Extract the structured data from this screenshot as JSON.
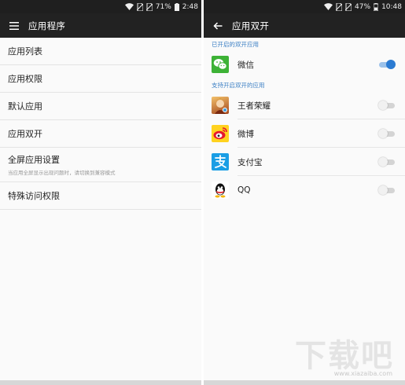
{
  "left": {
    "status": {
      "battery": "71%",
      "time": "2:48"
    },
    "title": "应用程序",
    "items": [
      {
        "label": "应用列表"
      },
      {
        "label": "应用权限"
      },
      {
        "label": "默认应用"
      },
      {
        "label": "应用双开"
      },
      {
        "label": "全屏应用设置",
        "sub": "当应用全屏显示出现问题时，请切换到兼容模式"
      },
      {
        "label": "特殊访问权限"
      }
    ]
  },
  "right": {
    "status": {
      "battery": "47%",
      "time": "10:48"
    },
    "title": "应用双开",
    "enabled_header": "已开启的双开应用",
    "enabled_apps": [
      {
        "name": "微信",
        "icon": "wechat-icon",
        "on": true
      }
    ],
    "supported_header": "支持开启双开的应用",
    "supported_apps": [
      {
        "name": "王者荣耀",
        "icon": "honor-of-kings-icon",
        "on": false
      },
      {
        "name": "微博",
        "icon": "weibo-icon",
        "on": false
      },
      {
        "name": "支付宝",
        "icon": "alipay-icon",
        "on": false
      },
      {
        "name": "QQ",
        "icon": "qq-icon",
        "on": false
      }
    ]
  },
  "watermark": {
    "logo": "下载吧",
    "url": "www.xiazaiba.com"
  },
  "colors": {
    "accent": "#2b7bd2",
    "section": "#3b7fc4",
    "appbar": "#222222",
    "statusbar": "#1f1f1f"
  }
}
